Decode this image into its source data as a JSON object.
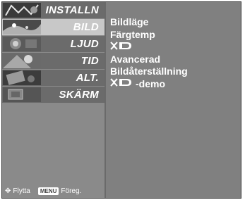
{
  "menu": {
    "items": [
      {
        "label": "INSTALLN",
        "icon": "install-thumbnail-icon"
      },
      {
        "label": "BILD",
        "icon": "picture-thumbnail-icon",
        "selected": true
      },
      {
        "label": "LJUD",
        "icon": "audio-thumbnail-icon"
      },
      {
        "label": "TID",
        "icon": "time-thumbnail-icon"
      },
      {
        "label": "ALT.",
        "icon": "option-thumbnail-icon"
      },
      {
        "label": "SKÄRM",
        "icon": "screen-thumbnail-icon"
      }
    ]
  },
  "submenu": {
    "items": [
      {
        "label": "Bildläge"
      },
      {
        "label": "Färgtemp"
      },
      {
        "logo": "XD",
        "label": ""
      },
      {
        "label": "Avancerad"
      },
      {
        "label": "Bildåterställning"
      },
      {
        "logo": "XD",
        "label": "-demo"
      }
    ]
  },
  "hint": {
    "move_label": "Flytta",
    "menu_key": "MENU",
    "prev_label": "Föreg."
  },
  "colors": {
    "panel_bg": "#808080",
    "sidebar_bg": "#8a8a8a",
    "item_bg": "#6b6b6b",
    "selected_bg": "#c8c8c8",
    "text": "#ffffff"
  }
}
